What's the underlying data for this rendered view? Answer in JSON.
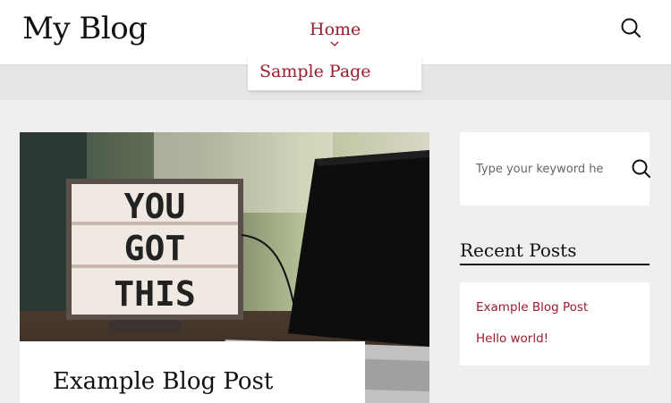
{
  "header": {
    "site_title": "My Blog",
    "nav": {
      "home_label": "Home"
    },
    "dropdown": {
      "items": [
        {
          "label": "Sample Page"
        }
      ]
    }
  },
  "featured_post": {
    "title": "Example Blog Post",
    "image_text": [
      "YOU",
      "GOT",
      "THIS"
    ]
  },
  "sidebar": {
    "search": {
      "placeholder": "Type your keyword he"
    },
    "recent_posts": {
      "heading": "Recent Posts",
      "items": [
        {
          "label": "Example Blog Post"
        },
        {
          "label": "Hello world!"
        }
      ]
    }
  },
  "colors": {
    "accent": "#9b1c2e",
    "text": "#111111",
    "background": "#efefef"
  },
  "icons": [
    "search-icon",
    "chevron-down-icon"
  ]
}
